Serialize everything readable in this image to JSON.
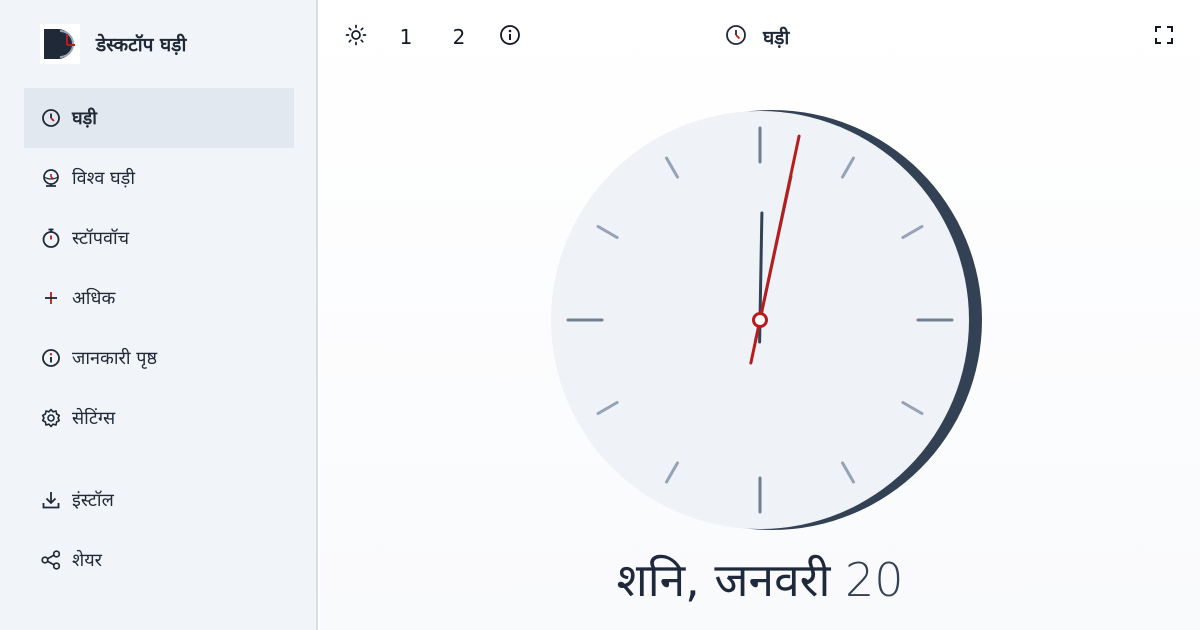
{
  "app": {
    "title": "डेस्कटॉप घड़ी",
    "accent": "#b91c1c",
    "dark": "#334155"
  },
  "sidebar": {
    "items": [
      {
        "label": "घड़ी",
        "icon": "clock-icon",
        "active": true
      },
      {
        "label": "विश्व घड़ी",
        "icon": "globe-clock-icon",
        "active": false
      },
      {
        "label": "स्टॉपवॉच",
        "icon": "stopwatch-icon",
        "active": false
      },
      {
        "label": "अधिक",
        "icon": "plus-icon",
        "active": false
      },
      {
        "label": "जानकारी पृष्ठ",
        "icon": "info-icon",
        "active": false
      },
      {
        "label": "सेटिंग्स",
        "icon": "gear-icon",
        "active": false
      },
      {
        "label": "इंस्टॉल",
        "icon": "download-icon",
        "active": false
      },
      {
        "label": "शेयर",
        "icon": "share-icon",
        "active": false
      }
    ]
  },
  "toolbar": {
    "theme_icon": "sun-icon",
    "preset_1": "1",
    "preset_2": "2",
    "info_icon": "info-icon",
    "center_title": "घड़ी",
    "center_icon": "clock-icon",
    "fullscreen_icon": "fullscreen-icon"
  },
  "clock": {
    "time": {
      "hours": 12,
      "minutes": 2,
      "seconds": 2
    },
    "hand_colors": {
      "hour": "#334155",
      "minute": "#64748b",
      "second": "#b91c1c"
    }
  },
  "date": {
    "weekday_month": "शनि, जनवरी",
    "day": "20"
  }
}
